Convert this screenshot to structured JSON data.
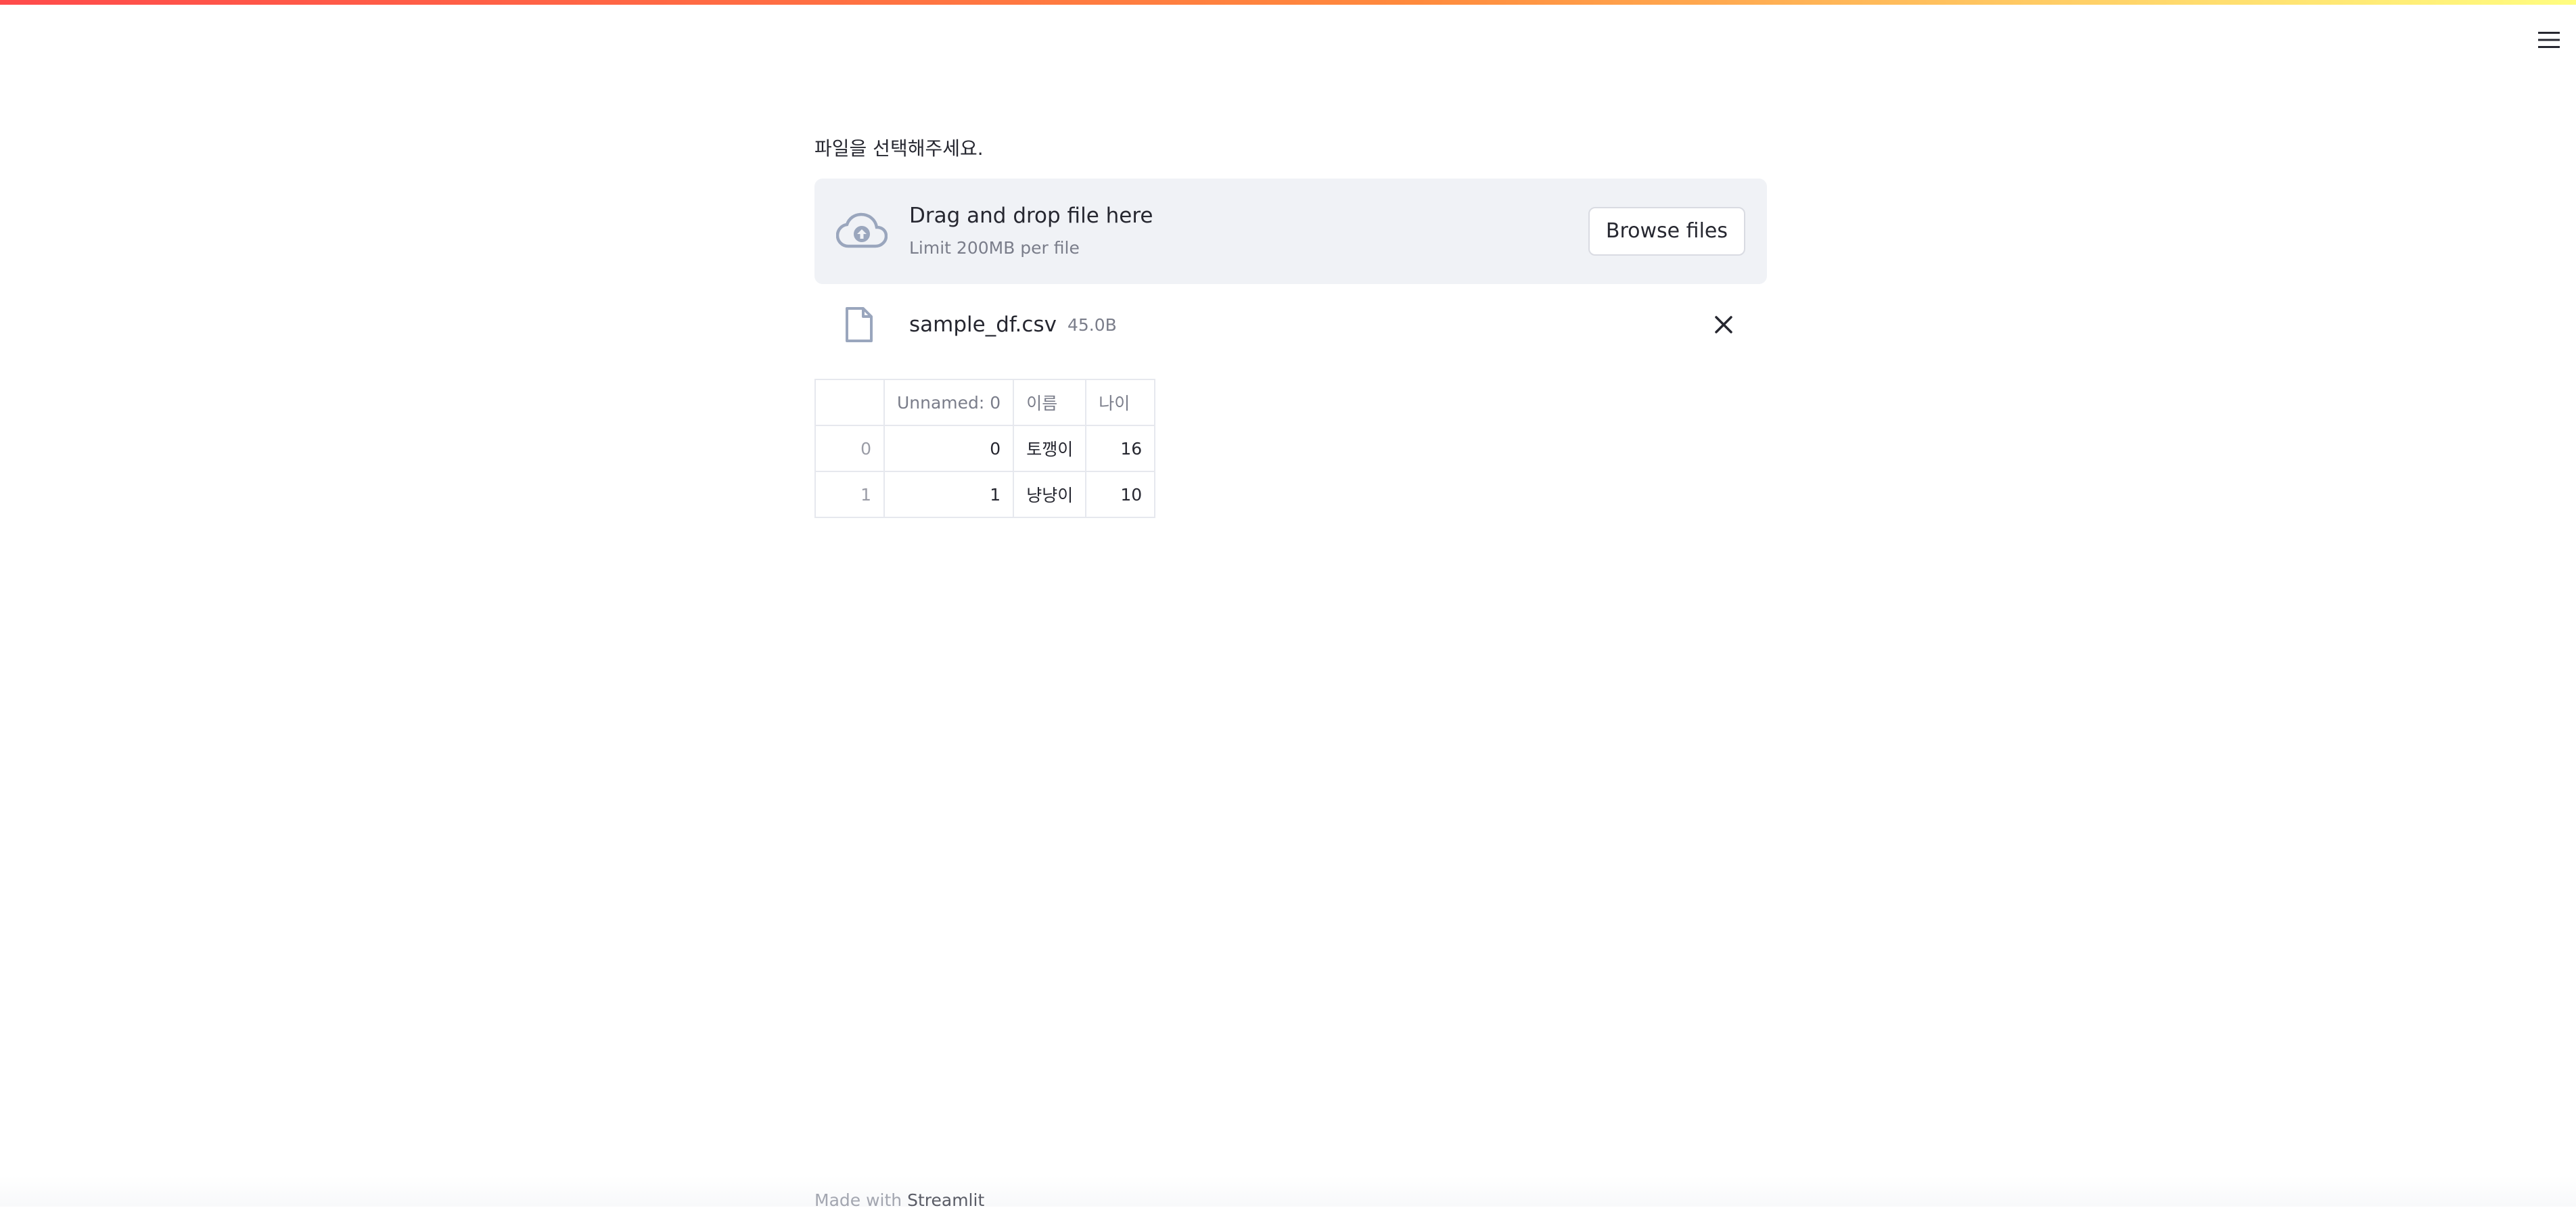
{
  "app": {
    "accent_gradient": [
      "#ff4b4b",
      "#ff8a3d",
      "#ffdb6e",
      "#fffd80"
    ],
    "menu_icon": "hamburger-menu-icon"
  },
  "uploader": {
    "label": "파일을 선택해주세요.",
    "drop_text": "Drag and drop file here",
    "limit_text": "Limit 200MB per file",
    "browse_label": "Browse files",
    "icon": "cloud-upload-icon"
  },
  "uploaded_file": {
    "name": "sample_df.csv",
    "size": "45.0B",
    "icon": "file-icon",
    "remove_icon": "close-icon"
  },
  "dataframe": {
    "columns": [
      "",
      "Unnamed: 0",
      "이름",
      "나이"
    ],
    "rows": [
      {
        "index": "0",
        "unnamed": "0",
        "name": "토깽이",
        "age": "16"
      },
      {
        "index": "1",
        "unnamed": "1",
        "name": "냥냥이",
        "age": "10"
      }
    ]
  },
  "footer": {
    "prefix": "Made with",
    "brand": "Streamlit"
  }
}
